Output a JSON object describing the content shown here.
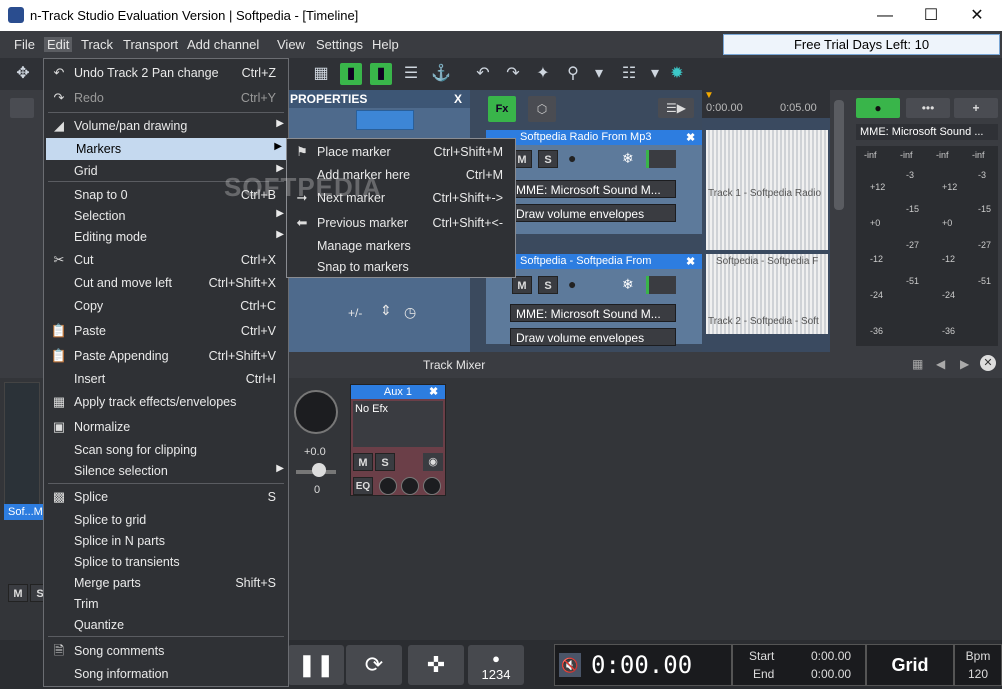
{
  "window": {
    "title": "n-Track Studio Evaluation Version | Softpedia - [Timeline]"
  },
  "menubar": {
    "items": [
      "File",
      "Edit",
      "Track",
      "Transport",
      "Add channel",
      "View",
      "Settings",
      "Help"
    ],
    "trial": "Free Trial Days Left: 10"
  },
  "props": {
    "title": "PROPERTIES",
    "plusminus": "+/-"
  },
  "tracks": [
    {
      "name": "Softpedia Radio From Mp3",
      "device": "MME: Microsoft Sound M...",
      "envelope_btn": "Draw volume envelopes"
    },
    {
      "name": "Softpedia - Softpedia From",
      "device": "MME: Microsoft Sound M...",
      "envelope_btn": "Draw volume envelopes"
    }
  ],
  "timeline": {
    "ruler": [
      "0:00.00",
      "0:05.00"
    ],
    "wave_labels": [
      "Track 1 - Softpedia Radio",
      "Softpedia - Softpedia F",
      "Track 2 - Softpedia - Soft"
    ]
  },
  "right_panel": {
    "device": "MME: Microsoft Sound ...",
    "meter_top": [
      "-inf",
      "-inf",
      "-inf",
      "-inf"
    ],
    "scale": [
      [
        "+12",
        "-3",
        "+12",
        "-3"
      ],
      [
        "+0",
        "-15",
        "+0",
        "-15"
      ],
      [
        "-12",
        "-27",
        "-12",
        "-27"
      ],
      [
        "-24",
        "-51",
        "-24",
        "-51"
      ],
      [
        "-36",
        "",
        "-36",
        ""
      ]
    ]
  },
  "mixer": {
    "title": "Track Mixer",
    "aux_name": "Aux 1",
    "aux_efx": "No Efx",
    "pan_value": "+0.0",
    "vol_value": "0",
    "eq": "EQ",
    "left_label": "Sof...M"
  },
  "transport": {
    "time": "0:00.00",
    "start_label": "Start",
    "start_value": "0:00.00",
    "end_label": "End",
    "end_value": "0:00.00",
    "grid": "Grid",
    "bpm_label": "Bpm",
    "bpm_value": "120",
    "metro_value": "1234"
  },
  "edit_menu": [
    {
      "label": "Undo Track 2 Pan change",
      "shortcut": "Ctrl+Z",
      "icon": "undo-icon"
    },
    {
      "label": "Redo",
      "shortcut": "Ctrl+Y",
      "icon": "redo-icon",
      "disabled": true
    },
    {
      "label": "Volume/pan drawing",
      "submenu": true,
      "icon": "envelope-icon"
    },
    {
      "label": "Markers",
      "submenu": true,
      "highlight": true
    },
    {
      "label": "Grid",
      "submenu": true
    },
    {
      "label": "Snap to 0",
      "shortcut": "Ctrl+B"
    },
    {
      "label": "Selection",
      "submenu": true
    },
    {
      "label": "Editing mode",
      "submenu": true
    },
    {
      "label": "Cut",
      "shortcut": "Ctrl+X",
      "icon": "scissors-icon"
    },
    {
      "label": "Cut and move left",
      "shortcut": "Ctrl+Shift+X"
    },
    {
      "label": "Copy",
      "shortcut": "Ctrl+C"
    },
    {
      "label": "Paste",
      "shortcut": "Ctrl+V",
      "icon": "paste-icon"
    },
    {
      "label": "Paste Appending",
      "shortcut": "Ctrl+Shift+V",
      "icon": "paste-icon"
    },
    {
      "label": "Insert",
      "shortcut": "Ctrl+I"
    },
    {
      "label": "Apply track effects/envelopes",
      "icon": "effects-icon"
    },
    {
      "label": "Normalize",
      "icon": "normalize-icon"
    },
    {
      "label": "Scan song for clipping"
    },
    {
      "label": "Silence selection",
      "submenu": true
    },
    {
      "label": "Splice",
      "shortcut": "S",
      "icon": "splice-icon"
    },
    {
      "label": "Splice to grid"
    },
    {
      "label": "Splice in N parts"
    },
    {
      "label": "Splice to transients"
    },
    {
      "label": "Merge parts",
      "shortcut": "Shift+S"
    },
    {
      "label": "Trim"
    },
    {
      "label": "Quantize"
    },
    {
      "label": "Song comments",
      "icon": "document-icon"
    },
    {
      "label": "Song information"
    }
  ],
  "markers_menu": [
    {
      "label": "Place marker",
      "shortcut": "Ctrl+Shift+M",
      "icon": "marker-icon"
    },
    {
      "label": "Add marker here",
      "shortcut": "Ctrl+M"
    },
    {
      "label": "Next marker",
      "shortcut": "Ctrl+Shift+->",
      "icon": "next-marker-icon"
    },
    {
      "label": "Previous marker",
      "shortcut": "Ctrl+Shift+<-",
      "icon": "prev-marker-icon"
    },
    {
      "label": "Manage markers"
    },
    {
      "label": "Snap to markers"
    }
  ]
}
